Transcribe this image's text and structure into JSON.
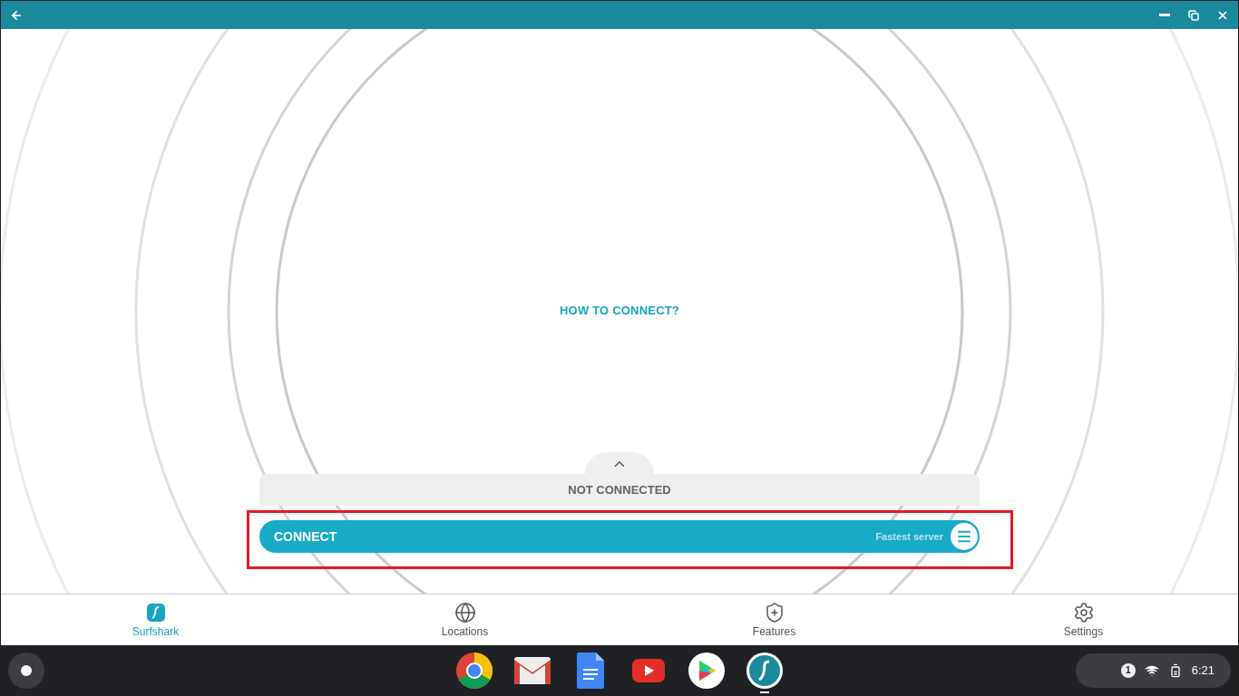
{
  "window": {
    "controls": [
      {
        "kind": "back"
      },
      {
        "kind": "minimize"
      },
      {
        "kind": "restore"
      },
      {
        "kind": "close"
      }
    ]
  },
  "main": {
    "help_link": "HOW TO CONNECT?",
    "status": "NOT CONNECTED",
    "connect_button": "CONNECT",
    "server": "Fastest server"
  },
  "nav": [
    {
      "kind": "logo",
      "label": "Surfshark",
      "selected": true
    },
    {
      "kind": "globe",
      "label": "Locations",
      "selected": false
    },
    {
      "kind": "shield",
      "label": "Features",
      "selected": false
    },
    {
      "kind": "gear",
      "label": "Settings",
      "selected": false
    }
  ],
  "shelf": {
    "apps": [
      {
        "kind": "chrome",
        "active": false
      },
      {
        "kind": "gmail",
        "active": false
      },
      {
        "kind": "docs",
        "active": false
      },
      {
        "kind": "youtube",
        "active": false
      },
      {
        "kind": "play",
        "active": false
      },
      {
        "kind": "surfshark",
        "active": true
      }
    ],
    "notifications": "1",
    "time": "6:21"
  }
}
